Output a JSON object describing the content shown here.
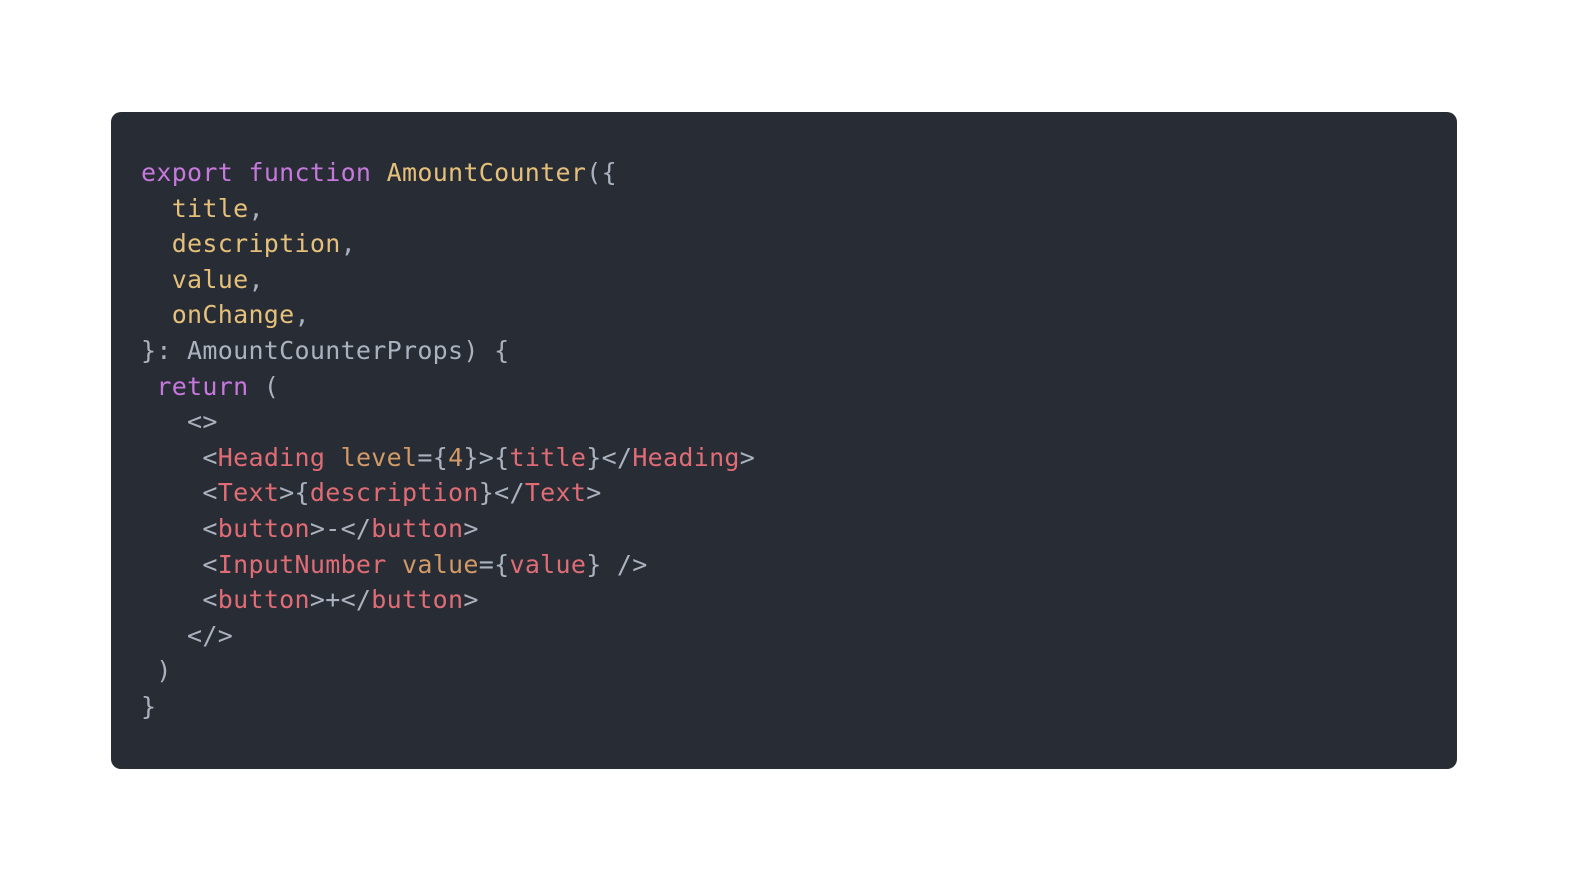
{
  "colors": {
    "background": "#ffffff",
    "card": "#282c34",
    "default": "#abb2bf",
    "keyword": "#c678dd",
    "function": "#e5c07b",
    "variable": "#e5c07b",
    "tag": "#e06c75",
    "attr": "#d19a66"
  },
  "code": {
    "lines": [
      [
        {
          "text": "export",
          "role": "keyword"
        },
        {
          "text": " ",
          "role": "default"
        },
        {
          "text": "function",
          "role": "keyword"
        },
        {
          "text": " ",
          "role": "default"
        },
        {
          "text": "AmountCounter",
          "role": "function"
        },
        {
          "text": "({",
          "role": "default"
        }
      ],
      [
        {
          "text": "  ",
          "role": "default"
        },
        {
          "text": "title",
          "role": "variable"
        },
        {
          "text": ",",
          "role": "default"
        }
      ],
      [
        {
          "text": "  ",
          "role": "default"
        },
        {
          "text": "description",
          "role": "variable"
        },
        {
          "text": ",",
          "role": "default"
        }
      ],
      [
        {
          "text": "  ",
          "role": "default"
        },
        {
          "text": "value",
          "role": "variable"
        },
        {
          "text": ",",
          "role": "default"
        }
      ],
      [
        {
          "text": "  ",
          "role": "default"
        },
        {
          "text": "onChange",
          "role": "variable"
        },
        {
          "text": ",",
          "role": "default"
        }
      ],
      [
        {
          "text": "}: AmountCounterProps) {",
          "role": "default"
        }
      ],
      [
        {
          "text": " ",
          "role": "default"
        },
        {
          "text": "return",
          "role": "keyword"
        },
        {
          "text": " (",
          "role": "default"
        }
      ],
      [
        {
          "text": "   <>",
          "role": "default"
        }
      ],
      [
        {
          "text": "    <",
          "role": "default"
        },
        {
          "text": "Heading",
          "role": "tag"
        },
        {
          "text": " ",
          "role": "default"
        },
        {
          "text": "level",
          "role": "attr"
        },
        {
          "text": "={",
          "role": "default"
        },
        {
          "text": "4",
          "role": "attr"
        },
        {
          "text": "}>{",
          "role": "default"
        },
        {
          "text": "title",
          "role": "tag"
        },
        {
          "text": "}</",
          "role": "default"
        },
        {
          "text": "Heading",
          "role": "tag"
        },
        {
          "text": ">",
          "role": "default"
        }
      ],
      [
        {
          "text": "    <",
          "role": "default"
        },
        {
          "text": "Text",
          "role": "tag"
        },
        {
          "text": ">{",
          "role": "default"
        },
        {
          "text": "description",
          "role": "tag"
        },
        {
          "text": "}</",
          "role": "default"
        },
        {
          "text": "Text",
          "role": "tag"
        },
        {
          "text": ">",
          "role": "default"
        }
      ],
      [
        {
          "text": "    <",
          "role": "default"
        },
        {
          "text": "button",
          "role": "tag"
        },
        {
          "text": ">-</",
          "role": "default"
        },
        {
          "text": "button",
          "role": "tag"
        },
        {
          "text": ">",
          "role": "default"
        }
      ],
      [
        {
          "text": "    <",
          "role": "default"
        },
        {
          "text": "InputNumber",
          "role": "tag"
        },
        {
          "text": " ",
          "role": "default"
        },
        {
          "text": "value",
          "role": "attr"
        },
        {
          "text": "={",
          "role": "default"
        },
        {
          "text": "value",
          "role": "tag"
        },
        {
          "text": "} />",
          "role": "default"
        }
      ],
      [
        {
          "text": "    <",
          "role": "default"
        },
        {
          "text": "button",
          "role": "tag"
        },
        {
          "text": ">+</",
          "role": "default"
        },
        {
          "text": "button",
          "role": "tag"
        },
        {
          "text": ">",
          "role": "default"
        }
      ],
      [
        {
          "text": "   </>",
          "role": "default"
        }
      ],
      [
        {
          "text": " )",
          "role": "default"
        }
      ],
      [
        {
          "text": "}",
          "role": "default"
        }
      ]
    ]
  }
}
